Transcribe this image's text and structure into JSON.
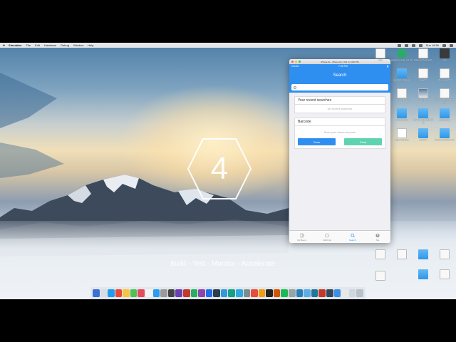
{
  "menubar": {
    "apple": "",
    "items": [
      "Simulator",
      "File",
      "Edit",
      "Hardware",
      "Debug",
      "Window",
      "Help"
    ],
    "clock": "Sun 16:56"
  },
  "desktop": {
    "logo_number": "4",
    "tagline": "Build - Test - Monitor - Accelerate"
  },
  "simulator": {
    "window_title": "iPhone 6s - iPhone 6s / iOS 9.2 (13C75)",
    "status": {
      "carrier": "Carrier",
      "time": "7:06 PM"
    },
    "nav_title": "Search",
    "search": {
      "value": "",
      "placeholder": ""
    },
    "recent": {
      "header": "Your recent searches",
      "empty": "No recent searches"
    },
    "barcode": {
      "header": "Barcode",
      "hint": "Scan your beers barcode",
      "scan_label": "Scan",
      "clear_label": "Clear"
    },
    "tabs": [
      {
        "label": "My Beers",
        "icon": "beer-icon"
      },
      {
        "label": "Wish list",
        "icon": "heart-icon"
      },
      {
        "label": "Search",
        "icon": "search-icon"
      },
      {
        "label": "Me",
        "icon": "person-icon"
      }
    ],
    "accent": "#2f8ff0",
    "clear_color": "#5fd3b0"
  },
  "desktop_icons": [
    {
      "label": "logs"
    },
    {
      "label": "analytics_data_out.bin"
    },
    {
      "label": "Backups.backupdb"
    },
    {
      "label": "pics"
    },
    {
      "label": "analytics_data.log"
    },
    {
      "label": "analytics"
    },
    {
      "label": "other_analytics"
    },
    {
      "label": "intermediates"
    },
    {
      "label": "Fla_data"
    },
    {
      "label": "Screen Shot 2016-06-14"
    },
    {
      "label": "terminal.png"
    },
    {
      "label": "Screen Shot 2016-06-16"
    },
    {
      "label": "pricing.png"
    },
    {
      "label": "logo_final.png"
    },
    {
      "label": "screens"
    },
    {
      "label": "backup_background"
    }
  ]
}
